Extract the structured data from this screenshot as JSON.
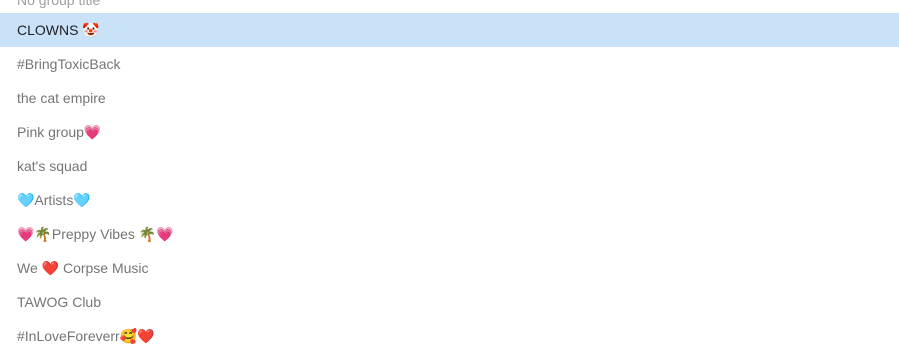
{
  "groups": [
    {
      "name": "No group title",
      "partial": true
    },
    {
      "name": "CLOWNS 🤡",
      "selected": true
    },
    {
      "name": "#BringToxicBack"
    },
    {
      "name": "the cat empire"
    },
    {
      "name": "Pink group💗"
    },
    {
      "name": "kat's squad"
    },
    {
      "name": "🩵Artists🩵"
    },
    {
      "name": "💗🌴Preppy Vibes 🌴💗"
    },
    {
      "name": "We ❤️ Corpse Music"
    },
    {
      "name": "TAWOG Club"
    },
    {
      "name": "#InLoveForeverr🥰❤️"
    }
  ],
  "colors": {
    "selected_background": "#c9e2f8",
    "text": "#757575",
    "selected_text": "#202124"
  }
}
